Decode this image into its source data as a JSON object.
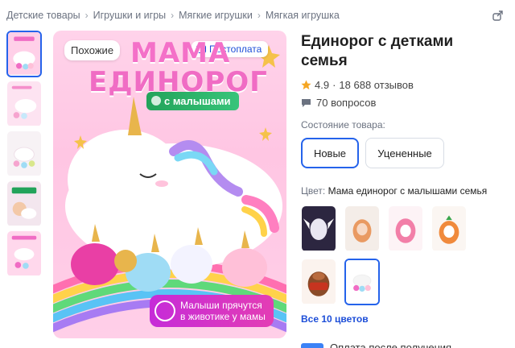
{
  "breadcrumbs": [
    "Детские товары",
    "Игрушки и игры",
    "Мягкие игрушки",
    "Мягкая игрушка"
  ],
  "product": {
    "title": "Единорог с детками семья",
    "rating": "4.9",
    "reviews": "18 688 отзывов",
    "questions": "70 вопросов"
  },
  "main_image": {
    "similar_label": "Похожие",
    "postpay_label": "Постоплата",
    "headline_1": "МАМА",
    "headline_2": "ЕДИНОРОГ",
    "babies_label": "с малышами",
    "hide_label": "Малыши прячутся в животике у мамы"
  },
  "condition": {
    "label": "Состояние товара:",
    "options": [
      "Новые",
      "Уцененные"
    ],
    "selected": "Новые"
  },
  "color": {
    "label": "Цвет:",
    "value": "Мама единорог с малышами семья",
    "all_colors": "Все 10 цветов"
  },
  "payment": {
    "label": "Оплата после получения"
  },
  "colors": {
    "accent": "#2563eb",
    "star": "#f5a623",
    "pink": "#f06cc4",
    "green": "#22a35a"
  }
}
